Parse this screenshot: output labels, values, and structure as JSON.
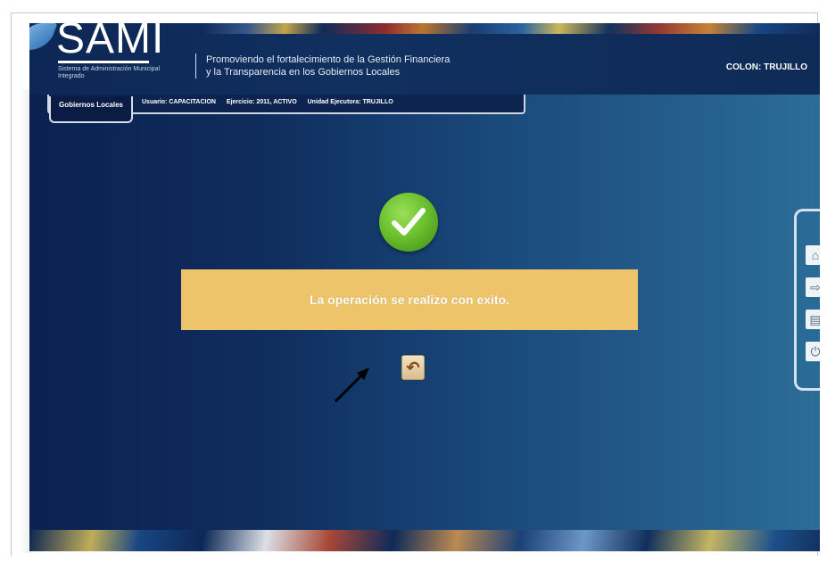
{
  "header": {
    "logo_text": "SAMI",
    "logo_subtitle": "Sistema de Administración Municipal Integrado",
    "tagline_line1": "Promoviendo el fortalecimiento de la Gestión Financiera",
    "tagline_line2": "y la Transparencia en los Gobiernos Locales",
    "right_label": "COLON: TRUJILLO"
  },
  "tabs": {
    "active_label": "Gobiernos Locales",
    "info": {
      "usuario": "Usuario: CAPACITACION",
      "ejercicio": "Ejercicio: 2011, ACTIVO",
      "unidad": "Unidad Ejecutora: TRUJILLO"
    }
  },
  "main": {
    "success_message": "La operación se realizo con exito.",
    "return_button_icon": "return-icon"
  },
  "side_toolbar": {
    "items": [
      "home-icon",
      "exit-icon",
      "document-icon",
      "power-icon"
    ]
  },
  "colors": {
    "message_bg": "#eec46b",
    "check_green": "#6cc02e",
    "header_navy": "#0d2755"
  }
}
